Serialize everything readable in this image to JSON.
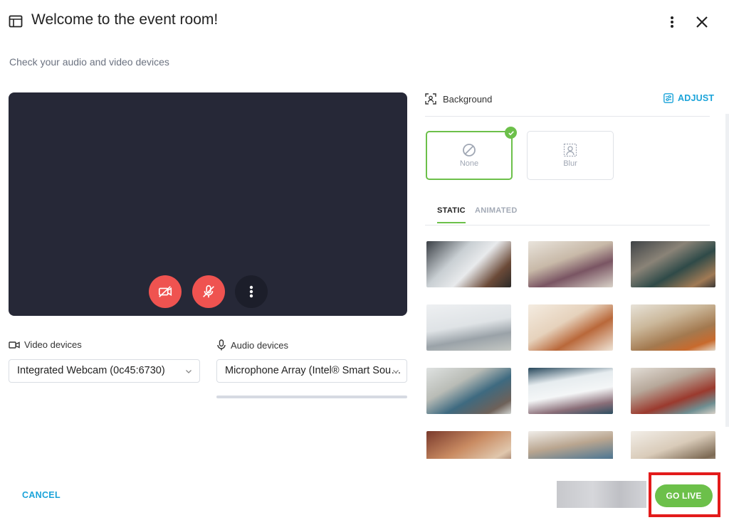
{
  "header": {
    "title": "Welcome to the event room!",
    "panel_icon": "sidebar-panel-icon",
    "more_icon": "more-vertical-icon",
    "close_icon": "close-icon"
  },
  "subtitle": "Check your audio and video devices",
  "preview": {
    "controls": [
      {
        "name": "camera-off-button",
        "icon": "camera-off-icon"
      },
      {
        "name": "mic-off-button",
        "icon": "mic-off-icon"
      },
      {
        "name": "more-options-button",
        "icon": "more-vertical-icon"
      }
    ]
  },
  "devices": {
    "video_label": "Video devices",
    "video_value": "Integrated Webcam (0c45:6730)",
    "audio_label": "Audio devices",
    "audio_value": "Microphone Array (Intel® Smart Sou…"
  },
  "background": {
    "label": "Background",
    "adjust_label": "ADJUST",
    "options": [
      {
        "label": "None",
        "selected": true
      },
      {
        "label": "Blur",
        "selected": false
      }
    ],
    "tabs": [
      {
        "label": "STATIC",
        "active": true
      },
      {
        "label": "ANIMATED",
        "active": false
      }
    ],
    "thumbnail_count_visible": 12
  },
  "footer": {
    "cancel_label": "CANCEL",
    "go_live_label": "GO LIVE"
  },
  "colors": {
    "accent_green": "#6cc04a",
    "link_blue": "#1aa3d9",
    "danger_red": "#ef5350",
    "highlight_red": "#e31b1b",
    "preview_bg": "#262837"
  }
}
